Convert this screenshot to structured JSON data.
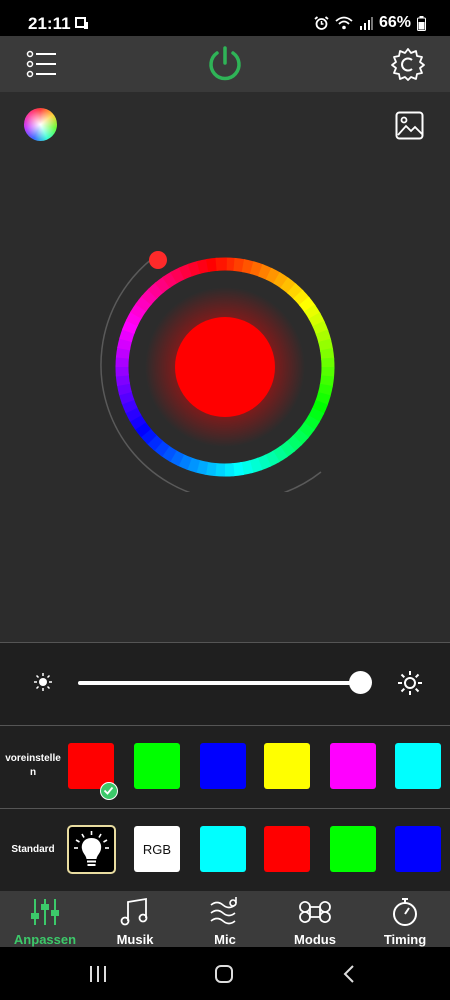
{
  "status_bar": {
    "time": "21:11",
    "battery": "66%",
    "icons": [
      "notification-icon",
      "alarm-icon",
      "wifi-icon",
      "signal-icon",
      "battery-icon"
    ]
  },
  "top_bar": {
    "icons": [
      "menu-list-icon",
      "power-icon",
      "settings-gear-icon"
    ],
    "power_color": "#2fb457"
  },
  "main": {
    "icons": [
      "color-palette-icon",
      "image-icon"
    ],
    "selected_color": "#ff0000"
  },
  "brightness": {
    "level": 1.0,
    "icons": [
      "sun-low-icon",
      "sun-high-icon"
    ]
  },
  "presets": {
    "label": "voreinstellen",
    "colors": [
      "#ff0000",
      "#00ff00",
      "#0000ff",
      "#ffff00",
      "#ff00ff",
      "#00ffff"
    ],
    "selected_index": 0
  },
  "standard": {
    "label": "Standard",
    "rgb_label": "RGB",
    "colors": [
      "#00ffff",
      "#ff0000",
      "#00ff00",
      "#0000ff"
    ]
  },
  "tabs": [
    {
      "label": "Anpassen",
      "icon": "sliders-icon",
      "active": true
    },
    {
      "label": "Musik",
      "icon": "music-note-icon",
      "active": false
    },
    {
      "label": "Mic",
      "icon": "microphone-wave-icon",
      "active": false
    },
    {
      "label": "Modus",
      "icon": "command-icon",
      "active": false
    },
    {
      "label": "Timing",
      "icon": "stopwatch-icon",
      "active": false
    }
  ],
  "accent_color": "#3cc96a"
}
